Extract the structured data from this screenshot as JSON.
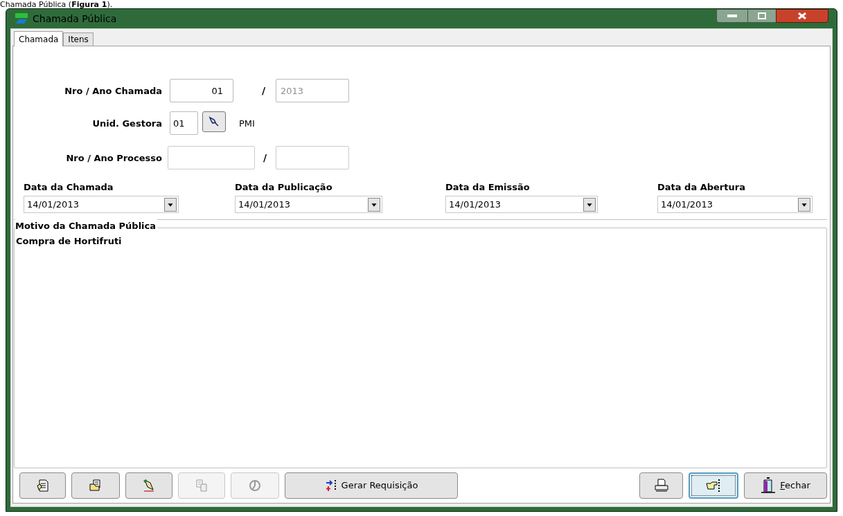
{
  "caption": "Chamada Pública (**Figura 1**).",
  "window": {
    "title": "Chamada Pública"
  },
  "tabs": [
    {
      "label": "Chamada",
      "selected": true
    },
    {
      "label": "Itens",
      "selected": false
    }
  ],
  "numero_chamada": {
    "label": "Nro / Ano Chamada",
    "number": "01",
    "year": "2013",
    "year_disabled": true
  },
  "unid_gestora": {
    "label": "Unid. Gestora",
    "code": "01",
    "name": "PMI"
  },
  "numero_processo": {
    "label": "Nro / Ano Processo"
  },
  "separator": "/",
  "dates": [
    {
      "label": "Data da Chamada",
      "value": "14/01/2013"
    },
    {
      "label": "Data da Publicação",
      "value": "14/01/2013"
    },
    {
      "label": "Data da Emissão",
      "value": "14/01/2013"
    },
    {
      "label": "Data da Abertura",
      "value": "14/01/2013"
    }
  ],
  "motivo": {
    "label": "Motivo da Chamada Pública",
    "value": "Compra de Hortifruti"
  },
  "left_buttons": [
    {
      "disabled": false
    },
    {
      "disabled": false
    },
    {
      "disabled": false
    },
    {
      "disabled": true
    },
    {
      "disabled": true
    },
    {
      "label": "Gerar Requisição",
      "disabled": false
    }
  ],
  "right_buttons": [
    {
      "focused": false
    },
    {
      "focused": true
    },
    {
      "label": "Fechar",
      "mnemonic": true,
      "focused": false
    }
  ]
}
